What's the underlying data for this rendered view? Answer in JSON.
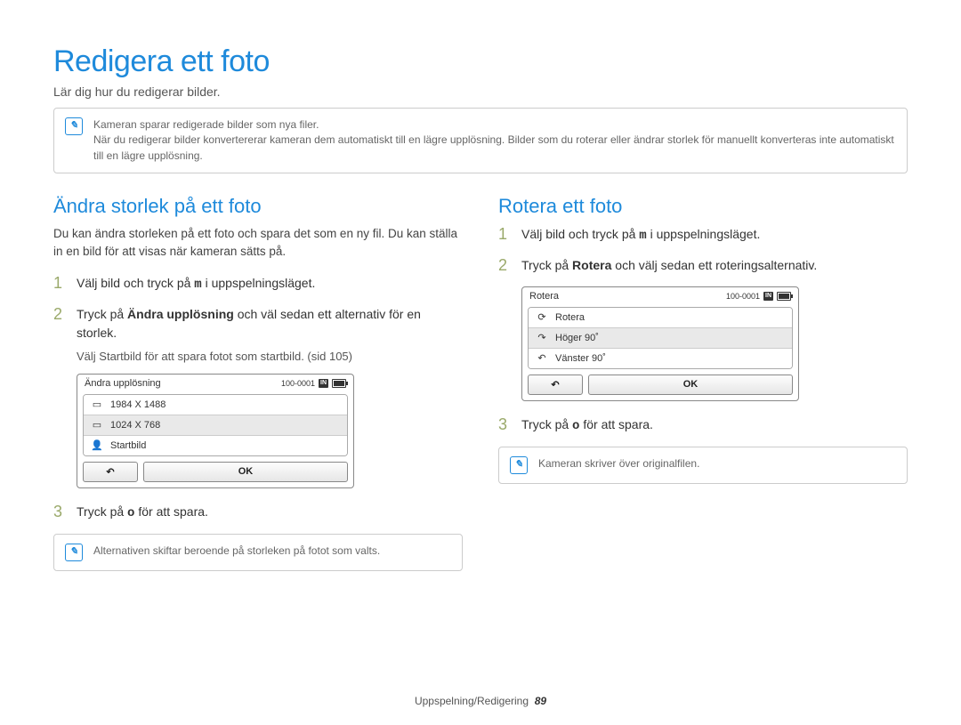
{
  "title": "Redigera ett foto",
  "subtitle": "Lär dig hur du redigerar bilder.",
  "top_note": {
    "line1": "Kameran sparar redigerade bilder som nya filer.",
    "line2": "När du redigerar bilder konvertererar kameran dem automatiskt till en lägre upplösning. Bilder som du roterar eller ändrar storlek för manuellt konverteras inte automatiskt till en lägre upplösning."
  },
  "left": {
    "heading": "Ändra storlek på ett foto",
    "lead": "Du kan ändra storleken på ett foto och spara det som en ny fil. Du kan ställa in en bild för att visas när kameran sätts på.",
    "step1_pre": "Välj bild och tryck på ",
    "step1_btn": "m",
    "step1_post": " i uppspelningsläget.",
    "step2_pre": "Tryck på ",
    "step2_bold": "Ändra upplösning",
    "step2_post": " och väl sedan ett alternativ för en storlek.",
    "step2_sub_pre": "Välj ",
    "step2_sub_bold": "Startbild",
    "step2_sub_post": " för att spara fotot som startbild. (sid 105)",
    "cam_title": "Ändra upplösning",
    "cam_counter": "100-0001",
    "cam_row1": "1984 X 1488",
    "cam_row2": "1024 X 768",
    "cam_row3": "Startbild",
    "cam_back": "↶",
    "cam_ok": "OK",
    "step3_pre": "Tryck på ",
    "step3_btn": "o",
    "step3_post": " för att spara.",
    "note": "Alternativen skiftar beroende på storleken på fotot som valts."
  },
  "right": {
    "heading": "Rotera ett foto",
    "step1_pre": "Välj bild och tryck på ",
    "step1_btn": "m",
    "step1_post": " i uppspelningsläget.",
    "step2_pre": "Tryck på ",
    "step2_bold": "Rotera",
    "step2_post": " och välj sedan ett roteringsalternativ.",
    "cam_title": "Rotera",
    "cam_counter": "100-0001",
    "cam_row1": "Rotera",
    "cam_row2": "Höger 90˚",
    "cam_row3": "Vänster 90˚",
    "cam_back": "↶",
    "cam_ok": "OK",
    "step3_pre": "Tryck på ",
    "step3_btn": "o",
    "step3_post": " för att spara.",
    "note": "Kameran skriver över originalfilen."
  },
  "footer_section": "Uppspelning/Redigering",
  "footer_page": "89"
}
